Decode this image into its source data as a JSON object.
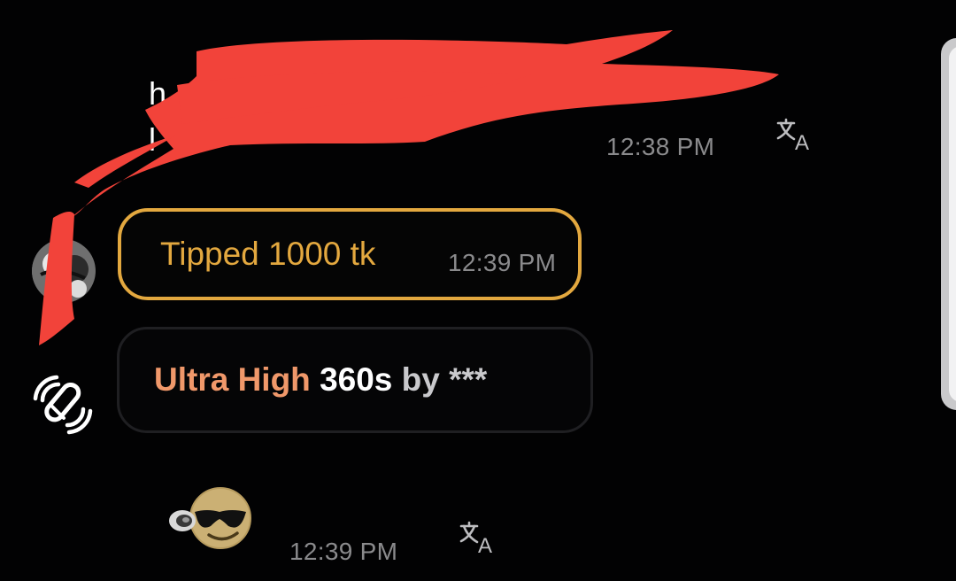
{
  "messages": [
    {
      "kind": "text",
      "lines": [
        "h",
        "l"
      ],
      "time": "12:38 PM",
      "translate_icon": "translate-icon"
    },
    {
      "kind": "tip",
      "text": "Tipped 1000 tk",
      "time": "12:39 PM",
      "avatar": "user-avatar"
    },
    {
      "kind": "toy-activation",
      "level_label": "Ultra High",
      "duration": "360s",
      "by_text": "by ***",
      "icon": "vibrating-toy-icon"
    },
    {
      "kind": "emoji",
      "emoji": "sunglasses-smiley",
      "time": "12:39 PM",
      "translate_icon": "translate-icon"
    }
  ],
  "colors": {
    "background": "#020203",
    "tip_accent": "#e3a83f",
    "ultra_label": "#f0986a",
    "timestamp": "#8a8a8c",
    "redaction": "#f2433a"
  }
}
